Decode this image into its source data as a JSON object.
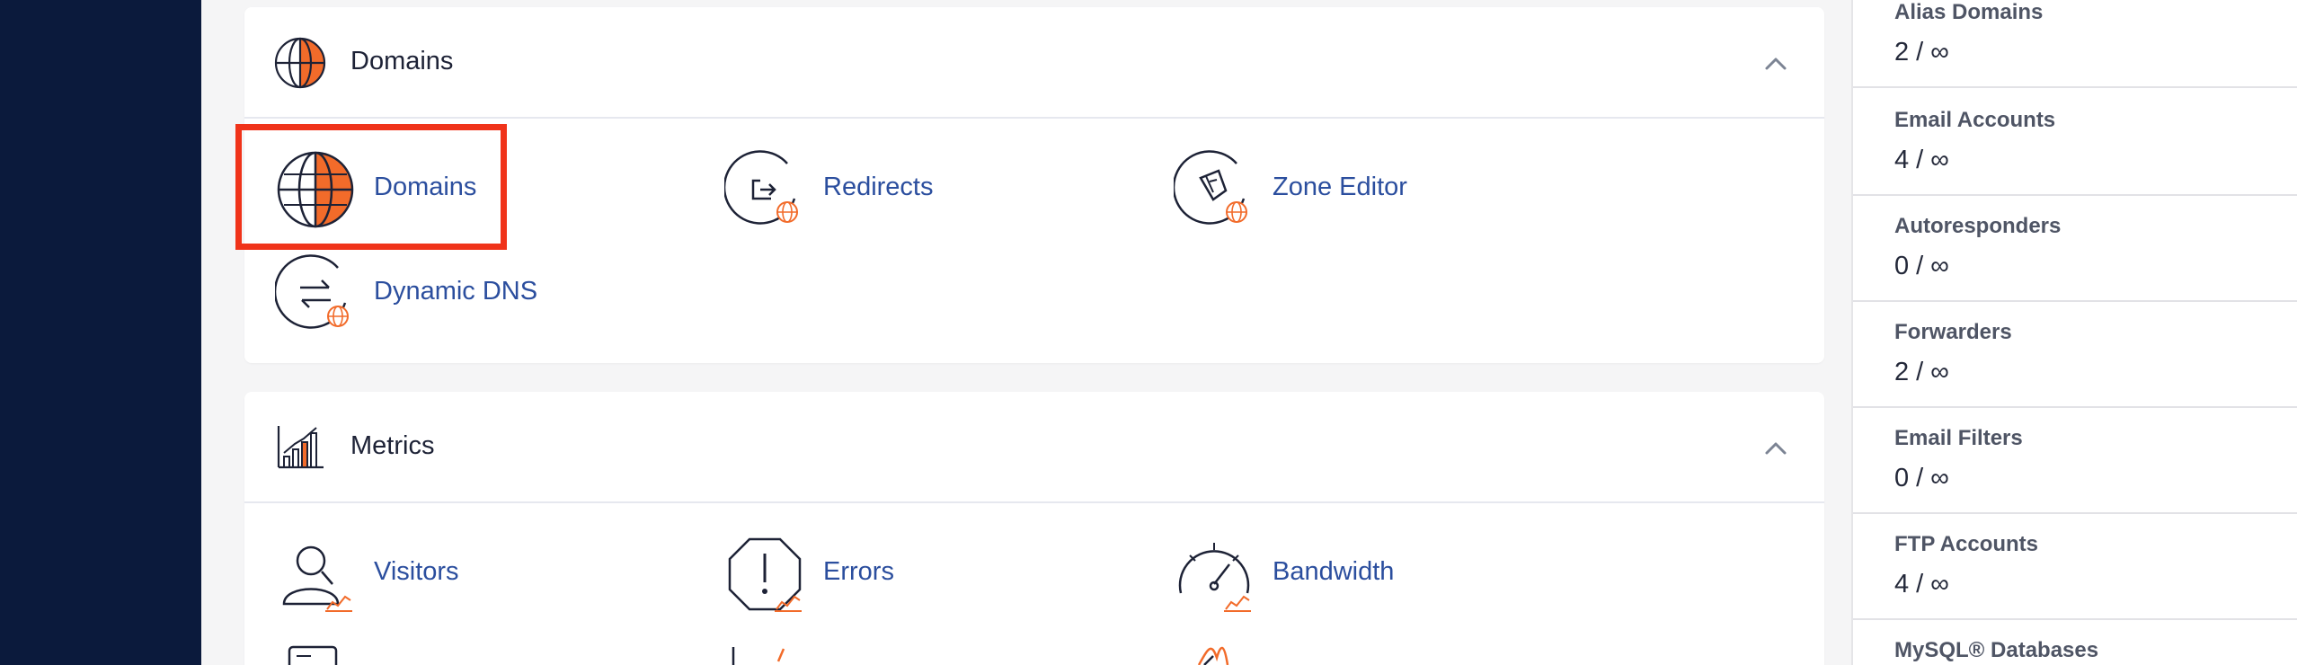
{
  "sections": {
    "domains": {
      "title": "Domains",
      "tools": [
        {
          "label": "Domains",
          "icon": "globe-icon"
        },
        {
          "label": "Redirects",
          "icon": "redirect-icon"
        },
        {
          "label": "Zone Editor",
          "icon": "zone-editor-icon"
        },
        {
          "label": "Dynamic DNS",
          "icon": "dynamic-dns-icon"
        }
      ]
    },
    "metrics": {
      "title": "Metrics",
      "tools": [
        {
          "label": "Visitors",
          "icon": "visitors-icon"
        },
        {
          "label": "Errors",
          "icon": "errors-icon"
        },
        {
          "label": "Bandwidth",
          "icon": "bandwidth-icon"
        }
      ]
    }
  },
  "stats": [
    {
      "label": "Alias Domains",
      "value": "2 / ∞"
    },
    {
      "label": "Email Accounts",
      "value": "4 / ∞"
    },
    {
      "label": "Autoresponders",
      "value": "0 / ∞"
    },
    {
      "label": "Forwarders",
      "value": "2 / ∞"
    },
    {
      "label": "Email Filters",
      "value": "0 / ∞"
    },
    {
      "label": "FTP Accounts",
      "value": "4 / ∞"
    },
    {
      "label": "MySQL® Databases",
      "value": ""
    }
  ],
  "colors": {
    "nav_bg": "#0b1a3c",
    "link": "#2b4e9e",
    "accent_orange": "#f26b2a",
    "highlight_red": "#f0331a"
  }
}
